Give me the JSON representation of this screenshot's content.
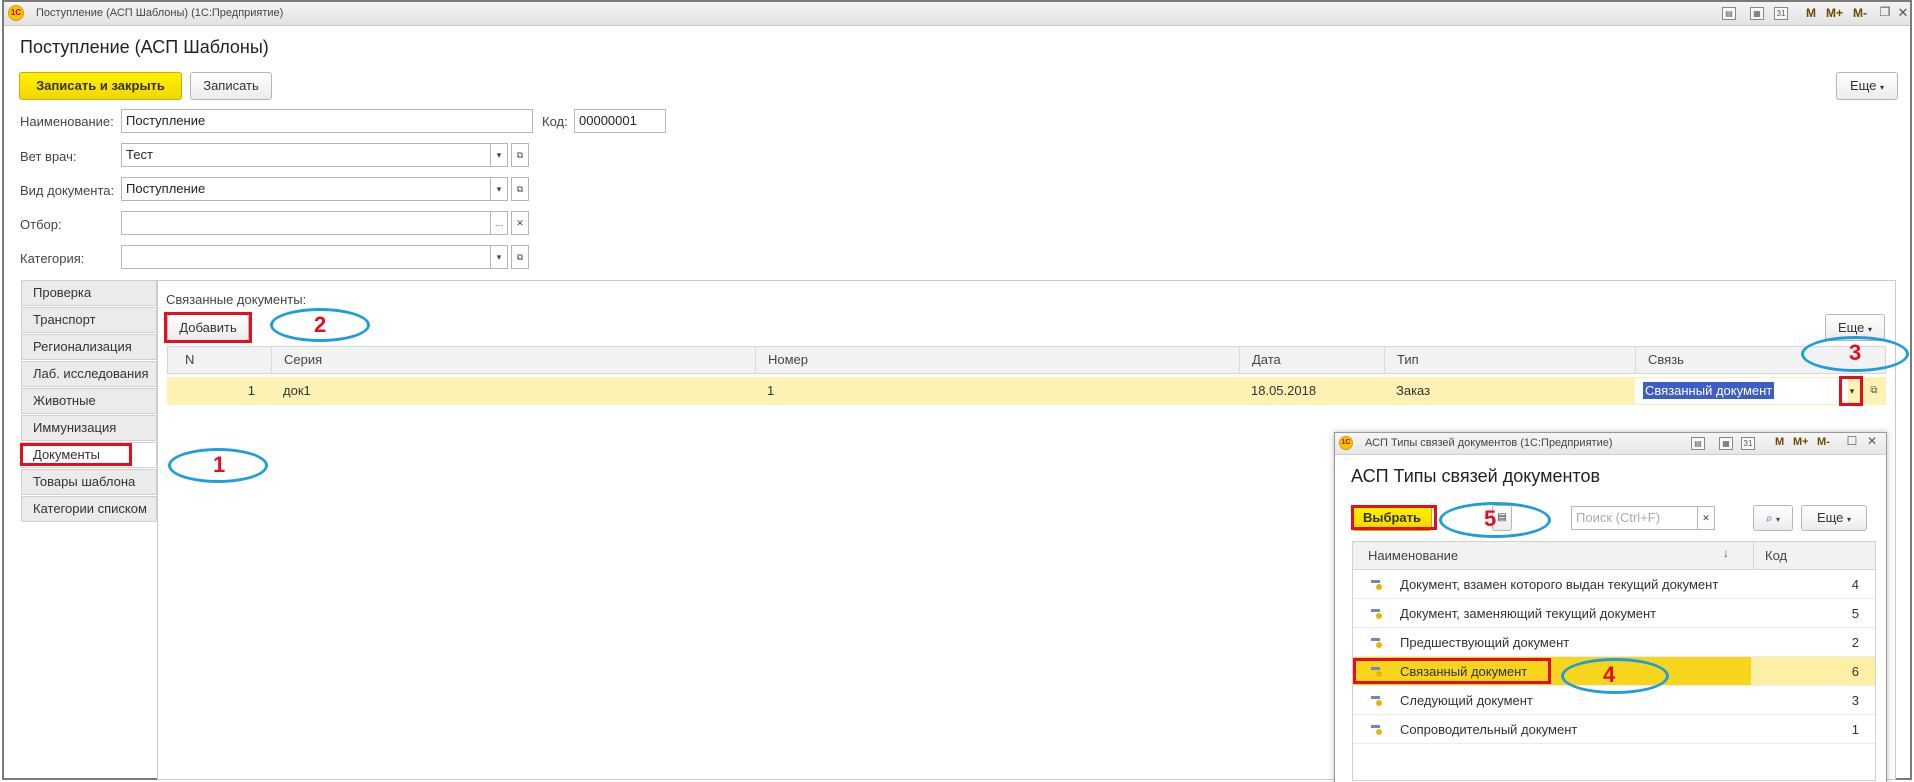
{
  "window": {
    "title": "Поступление (АСП Шаблоны)  (1С:Предприятие)",
    "toolbar_m": [
      "M",
      "M+",
      "M-"
    ]
  },
  "form": {
    "title": "Поступление (АСП Шаблоны)",
    "save_close_label": "Записать и закрыть",
    "save_label": "Записать",
    "more_label": "Еще"
  },
  "fields": {
    "name_label": "Наименование:",
    "name_value": "Поступление",
    "code_label": "Код:",
    "code_value": "00000001",
    "vet_label": "Вет врач:",
    "vet_value": "Тест",
    "doctype_label": "Вид документа:",
    "doctype_value": "Поступление",
    "filter_label": "Отбор:",
    "filter_value": "",
    "category_label": "Категория:",
    "category_value": ""
  },
  "tabs": [
    "Проверка",
    "Транспорт",
    "Регионализация",
    "Лаб. исследования",
    "Животные",
    "Иммунизация",
    "Документы",
    "Товары шаблона",
    "Категории списком"
  ],
  "linked": {
    "title": "Связанные документы:",
    "add_label": "Добавить",
    "more_label": "Еще",
    "columns": [
      "N",
      "Серия",
      "Номер",
      "Дата",
      "Тип",
      "Связь"
    ],
    "rows": [
      {
        "n": "1",
        "series": "док1",
        "number": "1",
        "date": "18.05.2018",
        "type": "Заказ",
        "link": "Связанный документ"
      }
    ]
  },
  "subwindow": {
    "title": "АСП Типы связей документов  (1С:Предприятие)",
    "heading": "АСП Типы связей документов",
    "select_label": "Выбрать",
    "search_placeholder": "Поиск (Ctrl+F)",
    "more_label": "Еще",
    "col_name": "Наименование",
    "col_code": "Код",
    "items": [
      {
        "name": "Документ, взамен которого выдан текущий документ",
        "code": "4"
      },
      {
        "name": "Документ, заменяющий текущий документ",
        "code": "5"
      },
      {
        "name": "Предшествующий документ",
        "code": "2"
      },
      {
        "name": "Связанный документ",
        "code": "6"
      },
      {
        "name": "Следующий документ",
        "code": "3"
      },
      {
        "name": "Сопроводительный документ",
        "code": "1"
      }
    ]
  },
  "annotations": [
    "1",
    "2",
    "3",
    "4",
    "5"
  ],
  "colors": {
    "accent_yellow": "#f2d600",
    "selected_row": "#fdf2b3",
    "annotation_red": "#e2101e",
    "annotation_blue": "#1f9ed9"
  }
}
